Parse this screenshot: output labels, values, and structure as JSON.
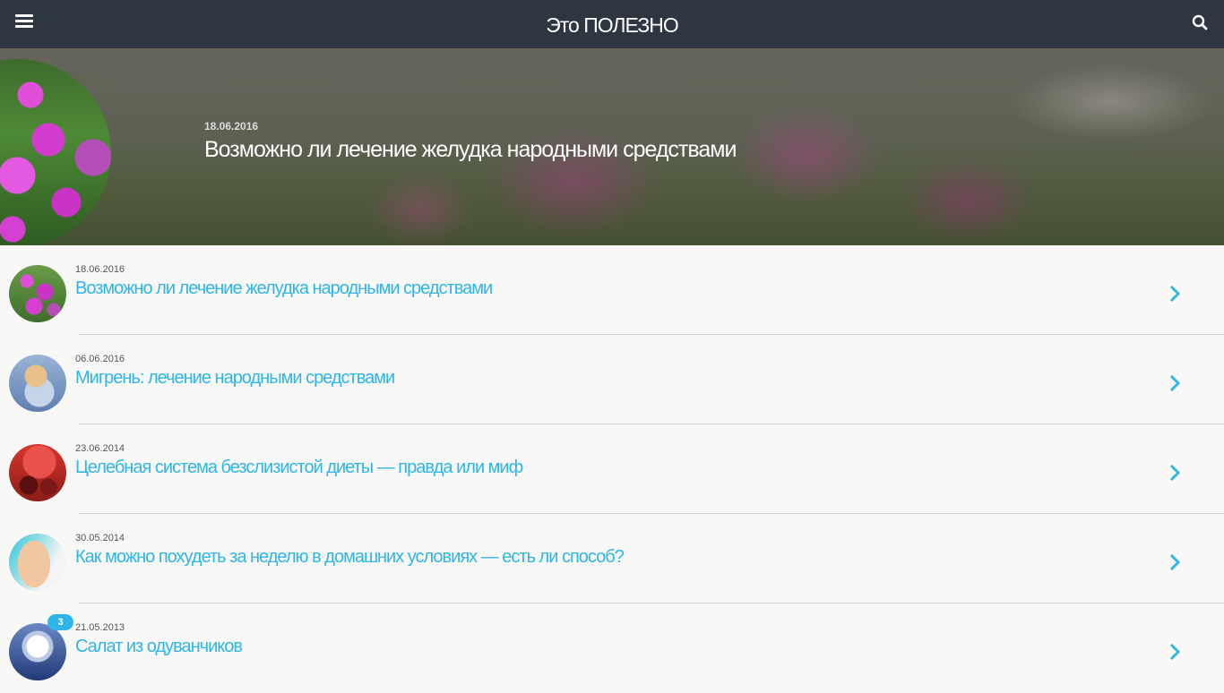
{
  "header": {
    "brand": "Это ПОЛЕЗНО",
    "menu_icon": "hamburger-menu-icon",
    "search_icon": "search-icon",
    "background_color": "#2e3641"
  },
  "featured": {
    "date": "18.06.2016",
    "title": "Возможно ли лечение желудка народными средствами"
  },
  "articles": [
    {
      "date": "18.06.2016",
      "title": "Возможно ли лечение желудка народными средствами",
      "badge": ""
    },
    {
      "date": "06.06.2016",
      "title": "Мигрень: лечение народными средствами",
      "badge": ""
    },
    {
      "date": "23.06.2014",
      "title": "Целебная система безслизистой диеты — правда или миф",
      "badge": ""
    },
    {
      "date": "30.05.2014",
      "title": "Как можно похудеть за неделю в домашних условиях — есть ли способ?",
      "badge": ""
    },
    {
      "date": "21.05.2013",
      "title": "Салат из одуванчиков",
      "badge": "3"
    }
  ],
  "colors": {
    "accent": "#2fb5e8",
    "list_background": "#f8f8f6"
  }
}
